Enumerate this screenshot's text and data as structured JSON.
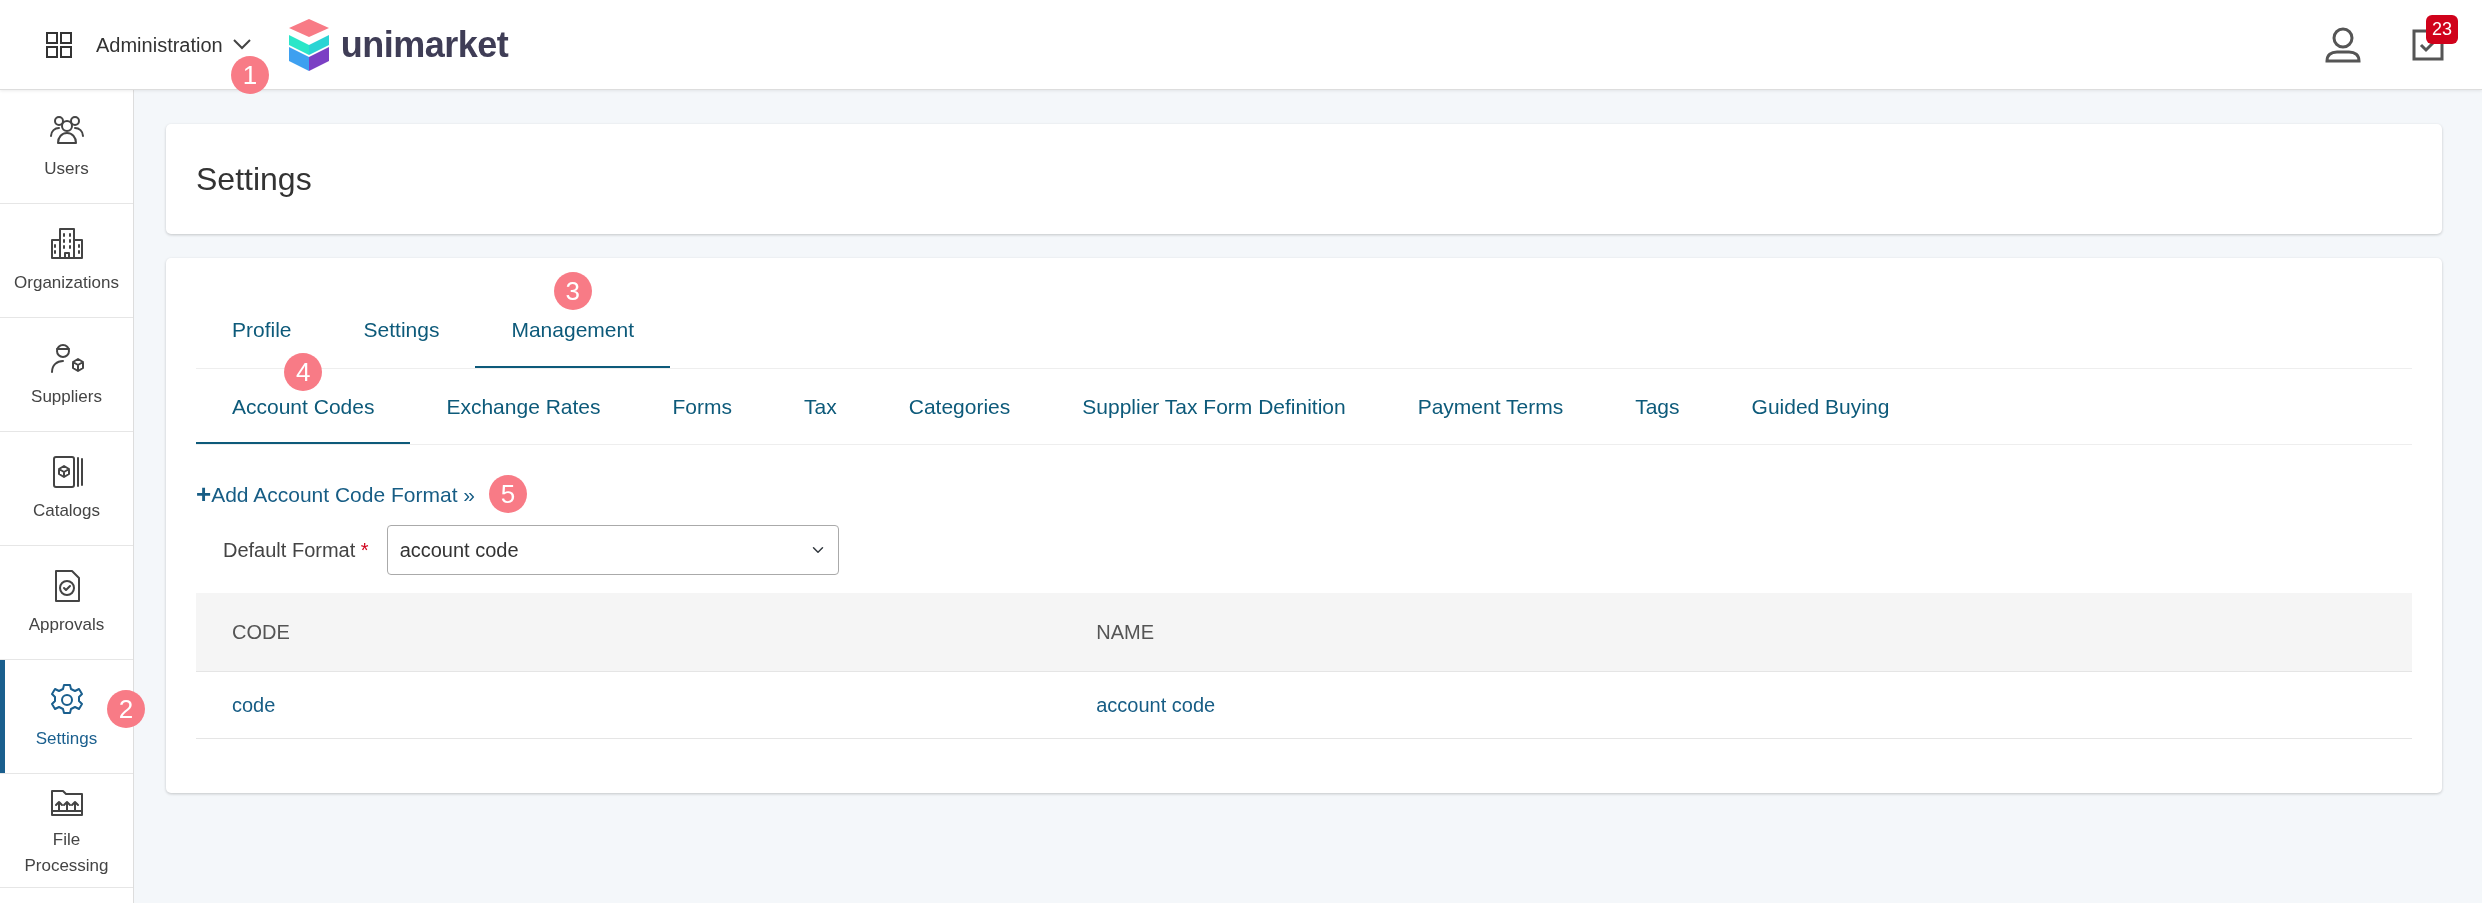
{
  "header": {
    "menu_label": "Administration",
    "menu_callout": "1",
    "logo_text": "unimarket",
    "tasks_badge": "23"
  },
  "sidebar": {
    "items": [
      {
        "label": "Users",
        "selected": false
      },
      {
        "label": "Organizations",
        "selected": false
      },
      {
        "label": "Suppliers",
        "selected": false
      },
      {
        "label": "Catalogs",
        "selected": false
      },
      {
        "label": "Approvals",
        "selected": false
      },
      {
        "label": "Settings",
        "selected": true,
        "callout": "2"
      },
      {
        "label": "File Processing",
        "selected": false
      }
    ]
  },
  "page_title": "Settings",
  "tabs": [
    {
      "label": "Profile",
      "selected": false
    },
    {
      "label": "Settings",
      "selected": false
    },
    {
      "label": "Management",
      "selected": true,
      "callout": "3"
    }
  ],
  "subtabs": [
    {
      "label": "Account Codes",
      "selected": true,
      "callout": "4"
    },
    {
      "label": "Exchange Rates",
      "selected": false
    },
    {
      "label": "Forms",
      "selected": false
    },
    {
      "label": "Tax",
      "selected": false
    },
    {
      "label": "Categories",
      "selected": false
    },
    {
      "label": "Supplier Tax Form Definition",
      "selected": false
    },
    {
      "label": "Payment Terms",
      "selected": false
    },
    {
      "label": "Tags",
      "selected": false
    },
    {
      "label": "Guided Buying",
      "selected": false
    }
  ],
  "add_link": {
    "icon_text": "+",
    "label": "Add Account Code Format »",
    "callout": "5"
  },
  "default_format": {
    "label": "Default Format",
    "required_mark": "*",
    "value": "account code"
  },
  "table": {
    "columns": [
      "CODE",
      "NAME"
    ],
    "rows": [
      [
        "code",
        "account code"
      ]
    ]
  }
}
